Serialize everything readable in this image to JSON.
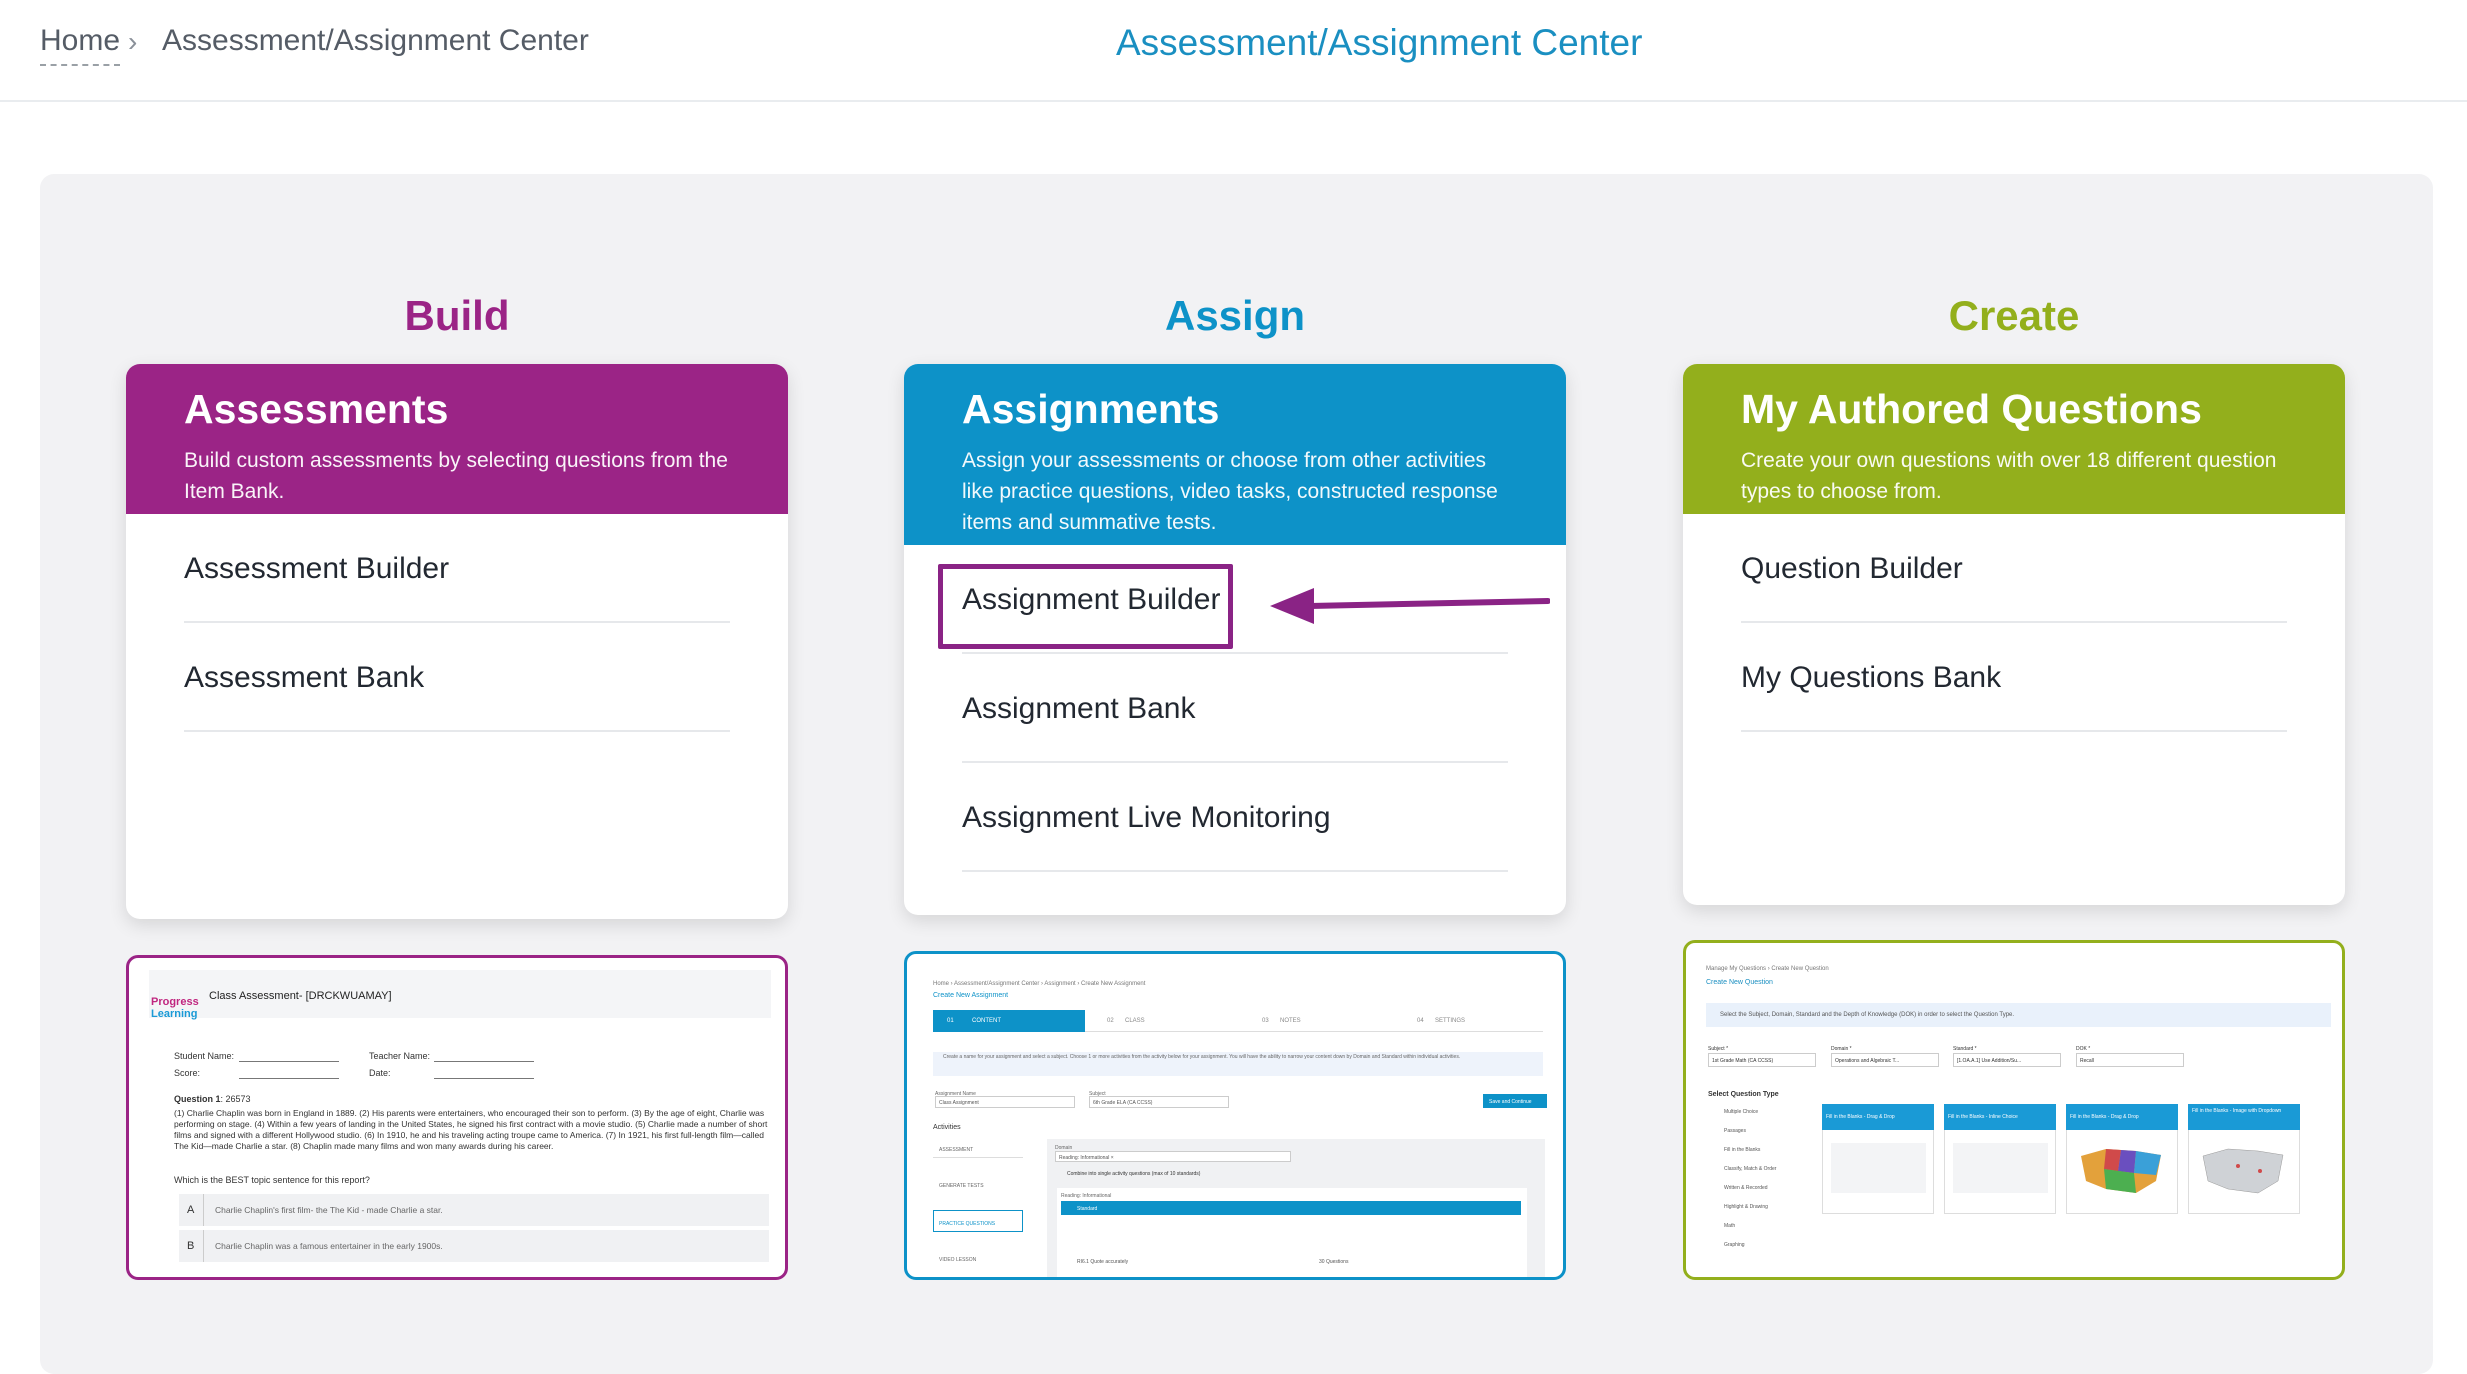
{
  "breadcrumb": {
    "home": "Home",
    "separator": "›",
    "current": "Assessment/Assignment Center"
  },
  "page_title": "Assessment/Assignment Center",
  "colors": {
    "build": "#9b2486",
    "assign": "#0d92c8",
    "create": "#93af1c",
    "title": "#1a8fc1",
    "highlight": "#8a2385"
  },
  "columns": {
    "build": {
      "heading": "Build",
      "title": "Assessments",
      "description": "Build custom assessments by selecting questions from the Item Bank.",
      "links": [
        "Assessment Builder",
        "Assessment Bank"
      ],
      "preview": {
        "logo_line1": "Progress",
        "logo_line2": "Learning",
        "doc_title": "Class Assessment- [DRCKWUAMAY]",
        "student_name": "Student Name:",
        "teacher_name": "Teacher Name:",
        "score": "Score:",
        "date": "Date:",
        "question_label": "Question 1",
        "question_id": ": 26573",
        "passage": "(1) Charlie Chaplin was born in England in 1889. (2) His parents were entertainers, who encouraged their son to perform. (3) By the age of eight, Charlie was performing on stage. (4) Within a few years of landing in the United States, he signed his first contract with a movie studio. (5) Charlie made a number of short films and signed with a different Hollywood studio. (6) In 1910, he and his traveling acting troupe came to America. (7) In 1921, his first full-length film—called The Kid—made Charlie a star. (8) Chaplin made many films and won many awards during his career.",
        "prompt": "Which is the BEST topic sentence for this report?",
        "option_a_letter": "A",
        "option_a_text": "Charlie Chaplin's first film- the The Kid - made Charlie a star.",
        "option_b_letter": "B",
        "option_b_text": "Charlie Chaplin was a famous entertainer in the early 1900s."
      }
    },
    "assign": {
      "heading": "Assign",
      "title": "Assignments",
      "description": "Assign your assessments or choose from other activities like practice questions, video tasks, constructed response items and summative tests.",
      "links": [
        "Assignment Builder",
        "Assignment Bank",
        "Assignment Live Monitoring"
      ],
      "preview": {
        "crumbs": "Home  ›  Assessment/Assignment Center  ›  Assignment  ›  Create New Assignment",
        "title": "Create New Assignment",
        "steps": [
          "CONTENT",
          "CLASS",
          "NOTES",
          "SETTINGS"
        ],
        "step_numbers": [
          "01",
          "02",
          "03",
          "04"
        ],
        "info": "Create a name for your assignment and select a subject. Choose 1 or more activities from the activity below for your assignment. You will have the ability to narrow your content down by Domain and Standard within individual activities.",
        "name_label": "Assignment Name",
        "name_value": "Class Assignment",
        "subject_label": "Subject",
        "subject_value": "6th Grade ELA (CA CCSS)",
        "save_button": "Save and Continue",
        "activities_label": "Activities",
        "activities": [
          "ASSESSMENT",
          "GENERATE TESTS",
          "PRACTICE QUESTIONS",
          "VIDEO LESSON"
        ],
        "domain_label": "Domain",
        "domain_tag": "Reading: Informational ×",
        "combine_text": "Combine into single activity questions (max of 10 standards)",
        "section_label": "Reading: Informational",
        "standard_header": "Standard",
        "row_label": "RI6.1 Quote accurately",
        "row_count": "30 Questions"
      }
    },
    "create": {
      "heading": "Create",
      "title": "My Authored Questions",
      "description": "Create your own questions with over 18 different question types to choose from.",
      "links": [
        "Question Builder",
        "My Questions Bank"
      ],
      "preview": {
        "crumbs": "Manage My Questions  ›  Create New Question",
        "title": "Create New Question",
        "info": "Select the Subject, Domain, Standard and the Depth of Knowledge (DOK) in order to select the Question Type.",
        "subject_label": "Subject *",
        "subject_value": "1st Grade Math (CA CCSS)",
        "domain_label": "Domain *",
        "domain_value": "Operations and Algebraic T...",
        "standard_label": "Standard *",
        "standard_value": "[1.OA.A.1] Use Addition/Su...",
        "dok_label": "DOK *",
        "dok_value": "Recall",
        "types_heading": "Select Question Type",
        "types": [
          "Multiple Choice",
          "Passages",
          "Fill in the Blanks",
          "Classify, Match & Order",
          "Written & Recorded",
          "Highlight & Drawing",
          "Math",
          "Graphing"
        ],
        "cards": [
          "Fill in the Blanks - Drag & Drop",
          "Fill in the Blanks - Inline Choice",
          "Fill in the Blanks - Drag & Drop",
          "Fill in the Blanks - Image with Dropdown"
        ]
      }
    }
  }
}
